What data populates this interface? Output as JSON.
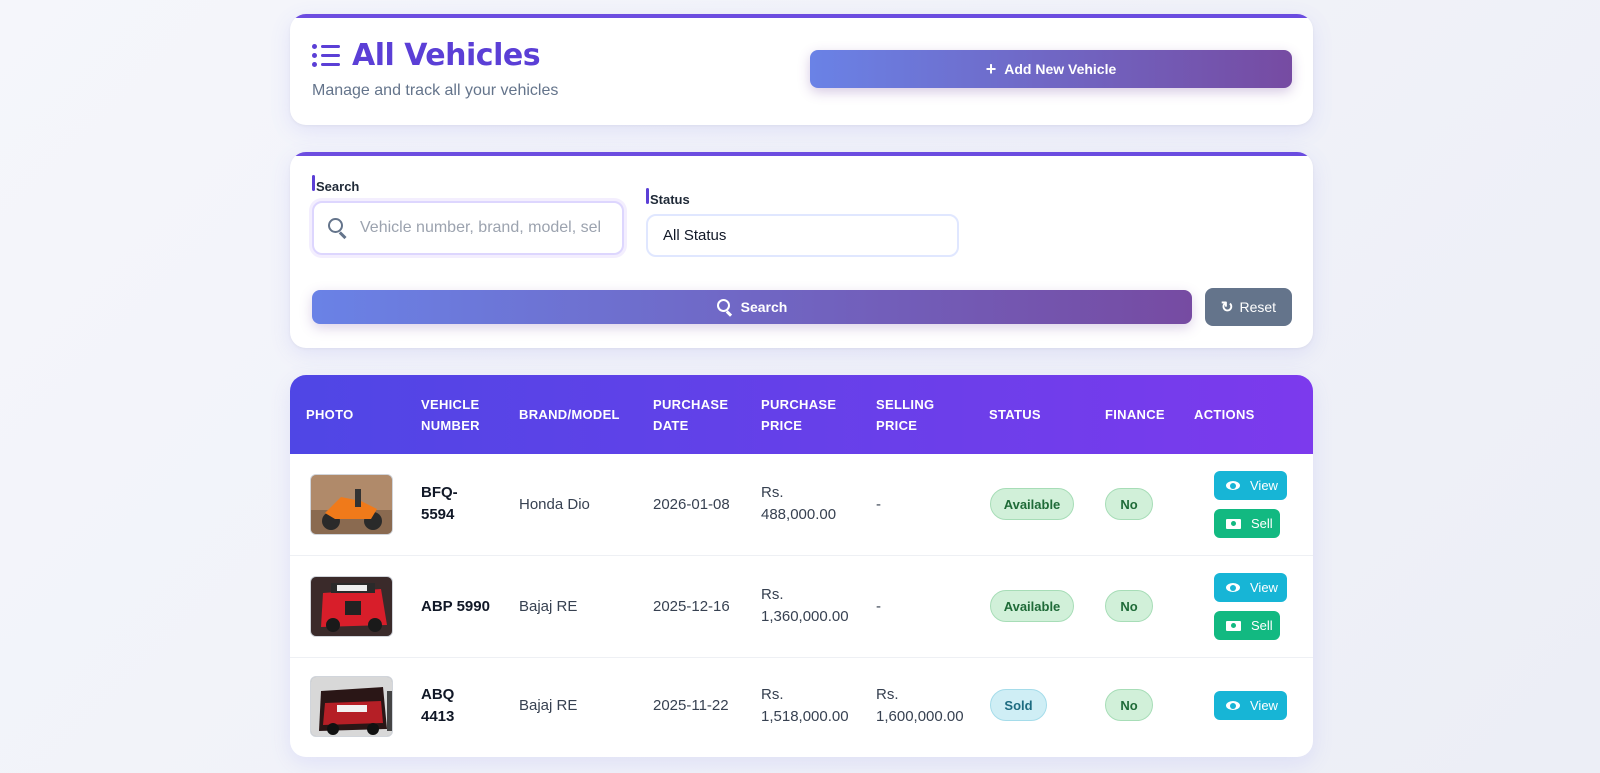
{
  "header": {
    "title": "All Vehicles",
    "subtitle": "Manage and track all your vehicles",
    "add_button": "Add New Vehicle"
  },
  "filters": {
    "search_label": "Search",
    "search_placeholder": "Vehicle number, brand, model, seller",
    "search_value": "",
    "status_label": "Status",
    "status_value": "All Status",
    "search_button": "Search",
    "reset_button": "Reset"
  },
  "table": {
    "headers": {
      "photo": "PHOTO",
      "vehicle_number_1": "VEHICLE",
      "vehicle_number_2": "NUMBER",
      "brand_model": "BRAND/MODEL",
      "purchase_date_1": "PURCHASE",
      "purchase_date_2": "DATE",
      "purchase_price_1": "PURCHASE",
      "purchase_price_2": "PRICE",
      "selling_price_1": "SELLING",
      "selling_price_2": "PRICE",
      "status": "STATUS",
      "finance": "FINANCE",
      "actions": "ACTIONS"
    },
    "rows": [
      {
        "vehicle_line1": "BFQ-",
        "vehicle_line2": "5594",
        "brand_model": "Honda Dio",
        "purchase_date": "2026-01-08",
        "purchase_price_1": "Rs.",
        "purchase_price_2": "488,000.00",
        "selling_price_1": "-",
        "selling_price_2": "",
        "status": "Available",
        "finance": "No",
        "view": "View",
        "sell": "Sell"
      },
      {
        "vehicle_line1": "ABP 5990",
        "vehicle_line2": "",
        "brand_model": "Bajaj RE",
        "purchase_date": "2025-12-16",
        "purchase_price_1": "Rs.",
        "purchase_price_2": "1,360,000.00",
        "selling_price_1": "-",
        "selling_price_2": "",
        "status": "Available",
        "finance": "No",
        "view": "View",
        "sell": "Sell"
      },
      {
        "vehicle_line1": "ABQ",
        "vehicle_line2": "4413",
        "brand_model": "Bajaj RE",
        "purchase_date": "2025-11-22",
        "purchase_price_1": "Rs.",
        "purchase_price_2": "1,518,000.00",
        "selling_price_1": "Rs.",
        "selling_price_2": "1,600,000.00",
        "status": "Sold",
        "finance": "No",
        "view": "View"
      }
    ]
  },
  "colors": {
    "accent": "#5b3fd6",
    "gradient_start": "#6a82e6",
    "gradient_end": "#764ba2",
    "view_button": "#17b5d6",
    "sell_button": "#12b981"
  }
}
